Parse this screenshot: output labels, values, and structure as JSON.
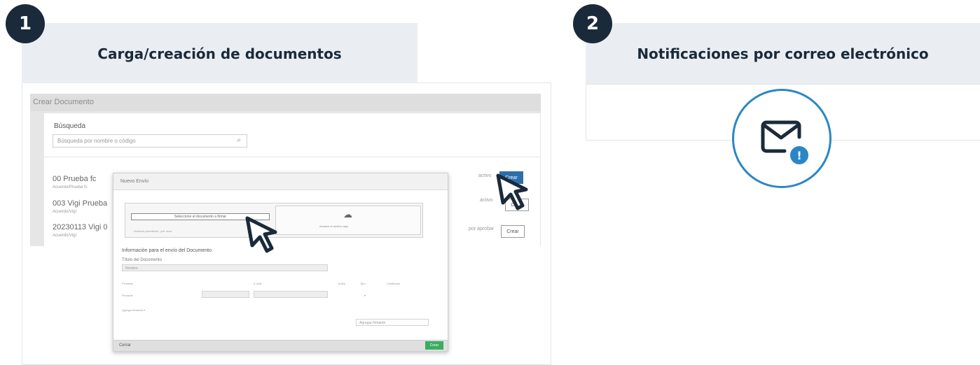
{
  "steps": [
    {
      "number": "1",
      "title": "Carga/creación de documentos"
    },
    {
      "number": "2",
      "title": "Notificaciones por correo electrónico"
    }
  ],
  "app": {
    "window_title": "Crear Documento",
    "search": {
      "label": "Búsqueda",
      "placeholder": "Búsqueda por nombre o código"
    },
    "documents": [
      {
        "name": "00 Prueba fc",
        "meta": "Acuerdo/Prueba fc"
      },
      {
        "name": "003 Vigi Prueba",
        "meta": "Acuerdo/Vigi"
      },
      {
        "name": "20230113 Vigi 0",
        "meta": "Acuerdo/Vigi"
      }
    ],
    "row_states": [
      "activo",
      "activo",
      "por aprobar"
    ],
    "create_label": "Crear",
    "modal": {
      "title": "Nuevo Envío",
      "select_button": "Seleccione el documento a firmar",
      "select_note": "Archivos permitidos: .pdf .docx",
      "drop_text": "Arrastre el archivo aquí",
      "section_title": "Información para el envío del Documento",
      "doc_title_label": "Título del Documento",
      "doc_title_value": "Nombre",
      "col_firmante": "Firmante",
      "col_email": "E-mail",
      "col_orden": "Orden",
      "col_tipo": "Tipo",
      "col_certificado": "Certificado",
      "row_firmante": "Firmante",
      "add_link": "Agregar firmante ▾",
      "add_button": "Agregar firmante",
      "footer_left": "Cerrar",
      "footer_right": "Crear"
    }
  },
  "colors": {
    "badge": "#1b2a3a",
    "accent_blue": "#2b86c5",
    "header_bg": "#eaeef3",
    "primary_button": "#2d6fa9",
    "green_button": "#3aad62"
  },
  "icons": [
    "mouse-cursor-icon",
    "envelope-icon",
    "alert-icon",
    "search-icon",
    "cloud-upload-icon"
  ]
}
